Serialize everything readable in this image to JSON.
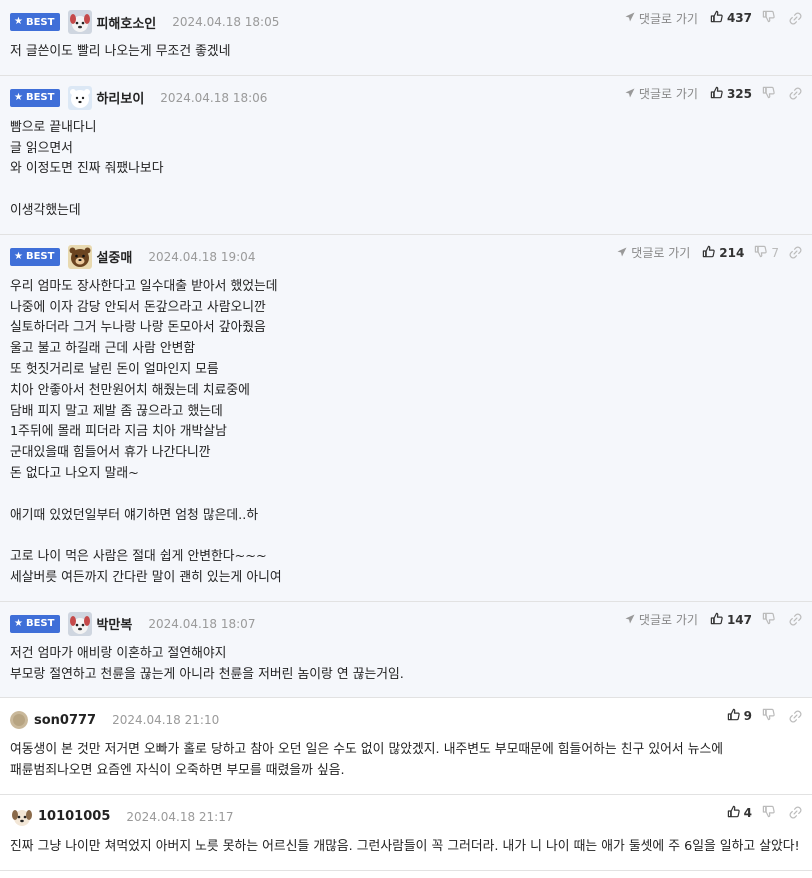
{
  "best_label": "BEST",
  "reply_label": "댓글로 가기",
  "colors": {
    "best_badge": "#3f6fd8",
    "best_bg": "#f5f7fb"
  },
  "comments": [
    {
      "best": true,
      "avatar": "puppy-avatar",
      "nick": "피해호소인",
      "date": "2024.04.18 18:05",
      "likes": "437",
      "dislikes": "",
      "lines": [
        "저 글쓴이도 빨리 나오는게 무조건 좋겠네"
      ]
    },
    {
      "best": true,
      "avatar": "polar-bear-avatar",
      "nick": "하리보이",
      "date": "2024.04.18 18:06",
      "likes": "325",
      "dislikes": "",
      "lines": [
        "빰으로 끝내다니",
        "글 읽으면서",
        "와 이정도면 진짜 줘팼나보다",
        "",
        "이생각했는데"
      ]
    },
    {
      "best": true,
      "avatar": "bear-avatar",
      "nick": "설중매",
      "date": "2024.04.18 19:04",
      "likes": "214",
      "dislikes": "7",
      "lines": [
        "우리 엄마도 장사한다고 일수대출 받아서 했었는데",
        "나중에 이자 감당 안되서 돈갚으라고 사람오니깐",
        "실토하더라 그거 누나랑 나랑 돈모아서 갚아줬음",
        "울고 불고 하길래 근데 사람 안변함",
        "또 헛짓거리로 날린 돈이 얼마인지 모름",
        "치아 안좋아서 천만원어치 해줬는데 치료중에",
        "담배 피지 말고 제발 좀 끊으라고 했는데",
        "1주뒤에 몰래 피더라 지금 치아 개박살남",
        "군대있을때 힘들어서 휴가 나간다니깐",
        "돈 없다고 나오지 말래~",
        "",
        "애기때 있었던일부터 얘기하면 엄청 많은데..하",
        "",
        "고로 나이 먹은 사람은 절대 쉽게 안변한다~~~",
        "세살버릇 여든까지 간다란 말이 괜히 있는게 아니여"
      ]
    },
    {
      "best": true,
      "avatar": "puppy-avatar",
      "nick": "박만복",
      "date": "2024.04.18 18:07",
      "likes": "147",
      "dislikes": "",
      "lines": [
        "저건 엄마가 애비랑 이혼하고 절연해야지",
        "부모랑 절연하고 천륜을 끊는게 아니라 천륜을 저버린 놈이랑 연 끊는거임."
      ]
    },
    {
      "best": false,
      "avatar": "round-avatar",
      "nick": "son0777",
      "date": "2024.04.18 21:10",
      "likes": "9",
      "dislikes": "",
      "lines": [
        "여동생이 본 것만 저거면 오빠가 홀로 당하고 참아 오던 일은 수도 없이 많았겠지. 내주변도 부모때문에 힘들어하는 친구 있어서 뉴스에 패륜범죄나오면 요즘엔 자식이 오죽하면 부모를 때렸을까 싶음."
      ]
    },
    {
      "best": false,
      "avatar": "dog-face-avatar",
      "nick": "10101005",
      "date": "2024.04.18 21:17",
      "likes": "4",
      "dislikes": "",
      "lines": [
        "진짜 그냥 나이만 쳐먹었지 아버지 노릇 못하는 어르신들 개많음. 그런사람들이 꼭 그러더라. 내가 니 나이 때는 애가 둘셋에 주 6일을 일하고 살았다!"
      ]
    }
  ]
}
